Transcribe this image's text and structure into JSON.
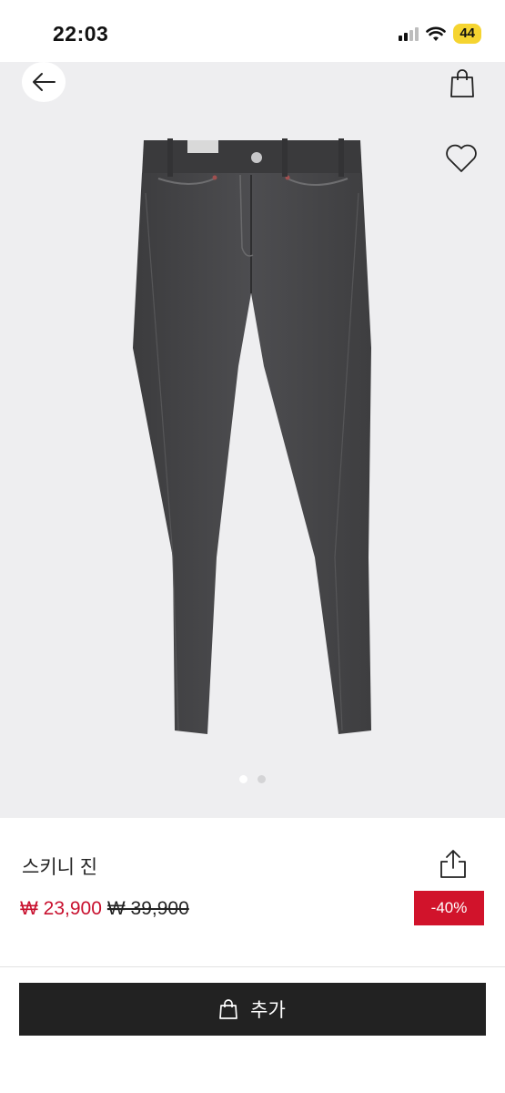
{
  "status_bar": {
    "time": "22:03",
    "battery": "44"
  },
  "gallery": {
    "icons": {
      "back": "arrow-left-icon",
      "bag": "shopping-bag-icon",
      "wishlist": "heart-icon"
    },
    "image_alt": "jeans-image",
    "page_count": 2,
    "active_page": 1
  },
  "product": {
    "name": "스키니 진",
    "price_now": "₩ 23,900",
    "price_old": "₩ 39,900",
    "discount": "-40%",
    "share_icon": "share-icon"
  },
  "actions": {
    "add_label": "추가",
    "add_icon": "shopping-bag-icon"
  },
  "colors": {
    "accent": "#c8102e",
    "badge": "#d1132b",
    "button": "#222222",
    "gallery_bg": "#eeeef0"
  }
}
